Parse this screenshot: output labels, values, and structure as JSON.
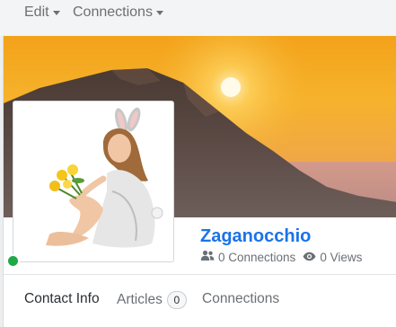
{
  "nav": {
    "edit_label": "Edit",
    "connections_label": "Connections"
  },
  "profile": {
    "name": "Zaganocchio",
    "connections_text": "0 Connections",
    "views_text": "0 Views",
    "online_status_color": "#20a845"
  },
  "tabs": [
    {
      "label": "Contact Info",
      "active": true
    },
    {
      "label": "Articles",
      "badge": "0"
    },
    {
      "label": "Connections"
    }
  ],
  "colors": {
    "accent": "#1a73e8",
    "muted_text": "#6b7075"
  },
  "icons": {
    "connections": "users-icon",
    "views": "eye-icon",
    "dropdown": "caret-down-icon"
  }
}
